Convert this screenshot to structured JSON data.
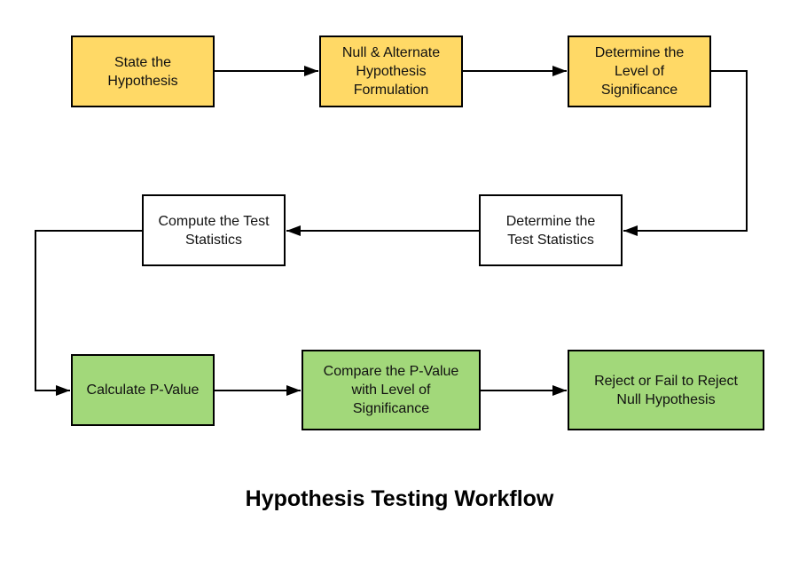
{
  "title": "Hypothesis Testing Workflow",
  "colors": {
    "step_yellow": "#ffd966",
    "step_white": "#ffffff",
    "step_green": "#a2d87a",
    "line": "#000000"
  },
  "nodes": [
    {
      "id": "state-hypothesis",
      "label": "State the\nHypothesis",
      "color": "yellow"
    },
    {
      "id": "null-alternate",
      "label": "Null & Alternate\nHypothesis\nFormulation",
      "color": "yellow"
    },
    {
      "id": "level-significance",
      "label": "Determine the\nLevel of\nSignificance",
      "color": "yellow"
    },
    {
      "id": "determine-test-stat",
      "label": "Determine the\nTest Statistics",
      "color": "white"
    },
    {
      "id": "compute-test-stat",
      "label": "Compute the Test\nStatistics",
      "color": "white"
    },
    {
      "id": "calc-p-value",
      "label": "Calculate P-Value",
      "color": "green"
    },
    {
      "id": "compare-p-value",
      "label": "Compare the P-Value\nwith Level of\nSignificance",
      "color": "green"
    },
    {
      "id": "reject-decision",
      "label": "Reject or Fail to Reject\nNull Hypothesis",
      "color": "green"
    }
  ],
  "edges": [
    {
      "from": "state-hypothesis",
      "to": "null-alternate"
    },
    {
      "from": "null-alternate",
      "to": "level-significance"
    },
    {
      "from": "level-significance",
      "to": "determine-test-stat"
    },
    {
      "from": "determine-test-stat",
      "to": "compute-test-stat"
    },
    {
      "from": "compute-test-stat",
      "to": "calc-p-value"
    },
    {
      "from": "calc-p-value",
      "to": "compare-p-value"
    },
    {
      "from": "compare-p-value",
      "to": "reject-decision"
    }
  ]
}
